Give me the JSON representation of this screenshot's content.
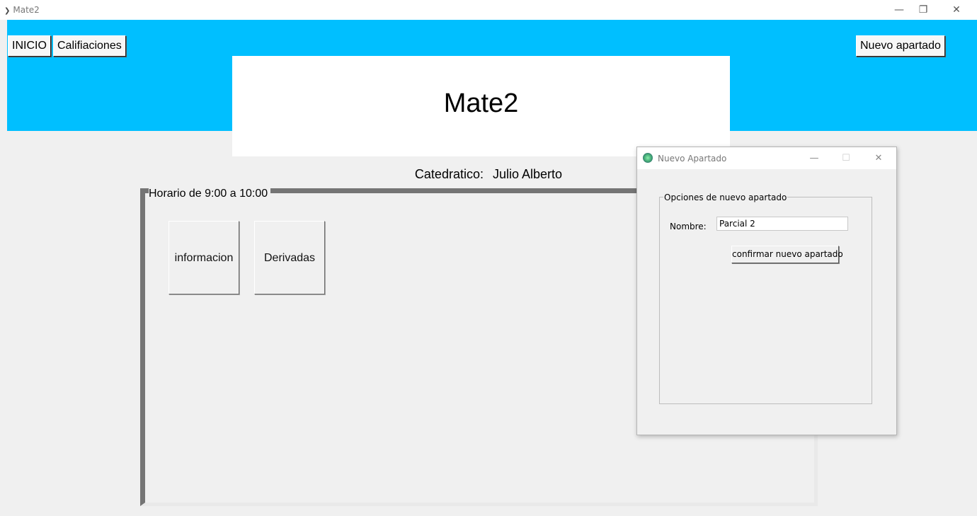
{
  "window": {
    "title": "Mate2",
    "minimize": "—",
    "restore": "❐",
    "close": "✕"
  },
  "toolbar": {
    "inicio": "INICIO",
    "calificaciones": "Califiaciones",
    "nuevo_apartado": "Nuevo apartado"
  },
  "course": {
    "title": "Mate2",
    "catedratico_label": "Catedratico:",
    "catedratico_name": "Julio Alberto"
  },
  "schedule": {
    "label": "Horario de 9:00 a 10:00",
    "buttons": [
      "informacion",
      "Derivadas"
    ]
  },
  "dialog": {
    "title": "Nuevo Apartado",
    "minimize": "—",
    "maximize": "☐",
    "close": "✕",
    "group_label": "Opciones de nuevo apartado",
    "name_label": "Nombre:",
    "name_value": "Parcial 2",
    "confirm_label": "confirmar nuevo apartado"
  },
  "colors": {
    "header": "#00bfff"
  }
}
